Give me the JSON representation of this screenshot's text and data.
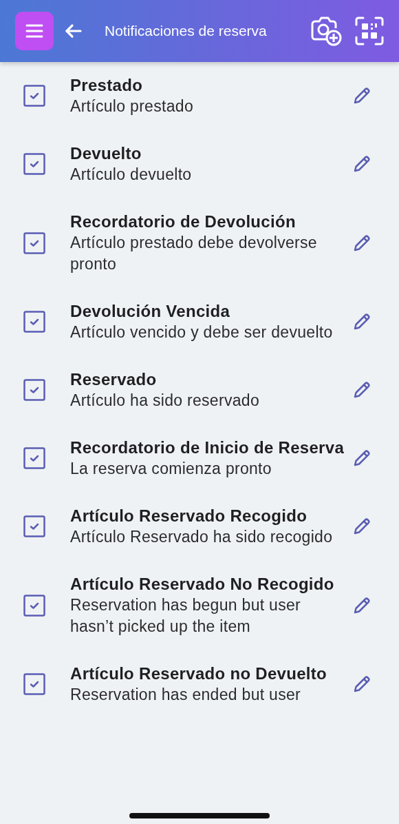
{
  "header": {
    "title": "Notificaciones de reserva"
  },
  "notifications": [
    {
      "title": "Prestado",
      "description": "Artículo prestado",
      "checked": true
    },
    {
      "title": "Devuelto",
      "description": "Artículo devuelto",
      "checked": true
    },
    {
      "title": "Recordatorio de Devolución",
      "description": "Artículo prestado debe devolverse pronto",
      "checked": true
    },
    {
      "title": "Devolución Vencida",
      "description": "Artículo vencido y debe ser devuelto",
      "checked": true
    },
    {
      "title": "Reservado",
      "description": "Artículo ha sido reservado",
      "checked": true
    },
    {
      "title": "Recordatorio de Inicio de Reserva",
      "description": "La reserva comienza pronto",
      "checked": true
    },
    {
      "title": "Artículo Reservado Recogido",
      "description": "Artículo Reservado ha sido recogido",
      "checked": true
    },
    {
      "title": "Artículo Reservado No Recogido",
      "description": "Reservation has begun but user hasn’t picked up the item",
      "checked": true
    },
    {
      "title": "Artículo Reservado no Devuelto",
      "description": "Reservation has ended but user",
      "checked": true
    }
  ]
}
